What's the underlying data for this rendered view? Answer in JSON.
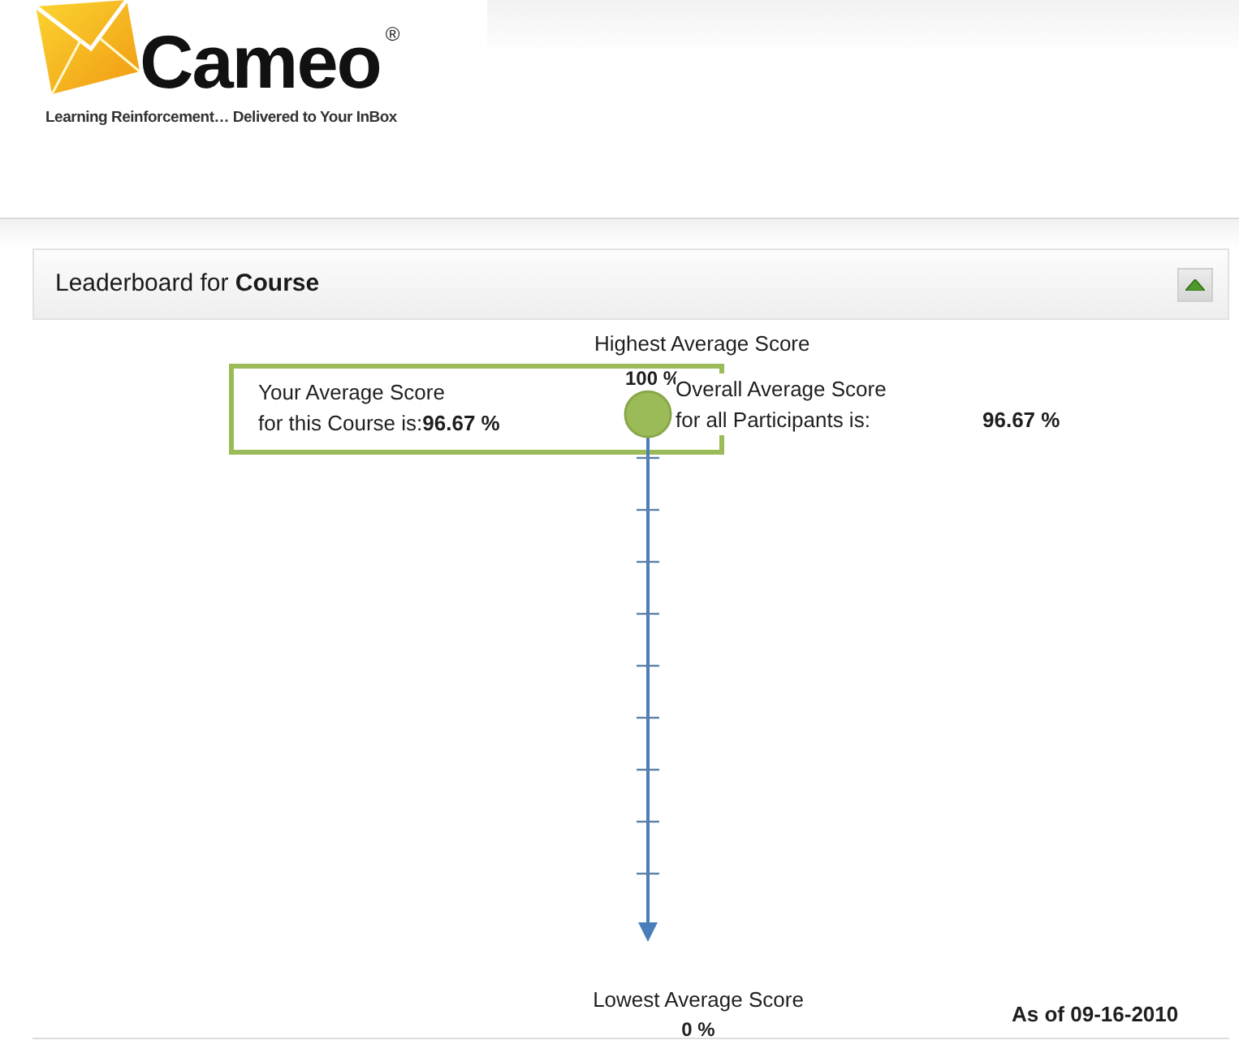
{
  "header": {
    "logo": {
      "wordmark": "Cameo",
      "registered_mark": "®",
      "tagline": "Learning Reinforcement… Delivered to Your InBox"
    }
  },
  "panel": {
    "title": "Leaderboard for **Course**",
    "expanded": true
  },
  "scale": {
    "top_label": "Highest Average Score",
    "top_value": "100 %",
    "marker": {
      "level": 0.9667
    },
    "bottom_label": "Lowest Average Score",
    "bottom_value": "0 %"
  },
  "your_score": {
    "label": "Your Average Score",
    "text": "for this Course is:**96.67 %**"
  },
  "overall_score": {
    "label": "Overall Average Score",
    "text": "for all Participants is:",
    "value": "96.67 %"
  },
  "as_of": "As of 09-16-2010"
}
